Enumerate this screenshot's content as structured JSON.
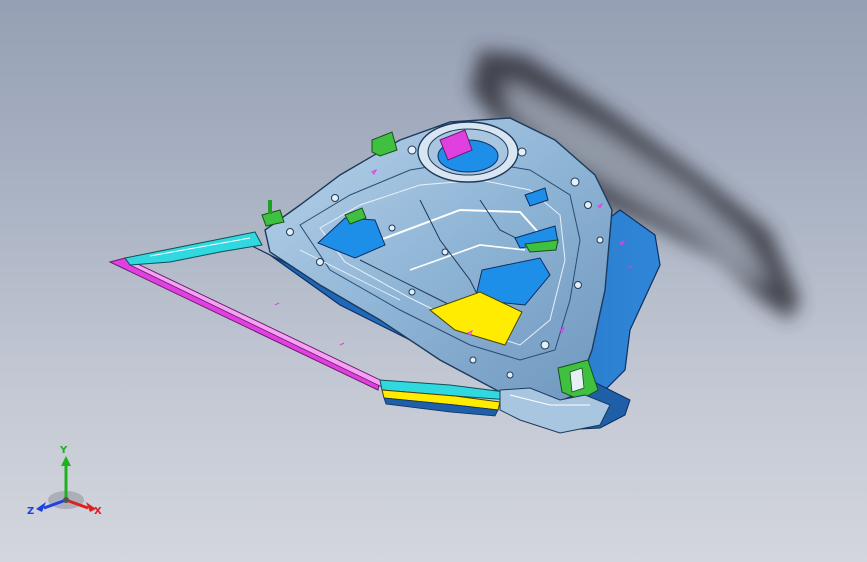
{
  "viewport": {
    "background_top": "#96a0b4",
    "background_bottom": "#d3d6dd"
  },
  "model": {
    "part_color": "#8fb8d8",
    "panel_blue": "#1e8fe8",
    "panel_yellow": "#ffec00",
    "accent_magenta": "#e040e0",
    "accent_cyan": "#30d8e0",
    "accent_green": "#40c040",
    "shadow_color": "#2a2d34"
  },
  "triad": {
    "x_label": "X",
    "y_label": "Y",
    "z_label": "Z",
    "x_color": "#e02020",
    "y_color": "#20b020",
    "z_color": "#2040e0"
  }
}
